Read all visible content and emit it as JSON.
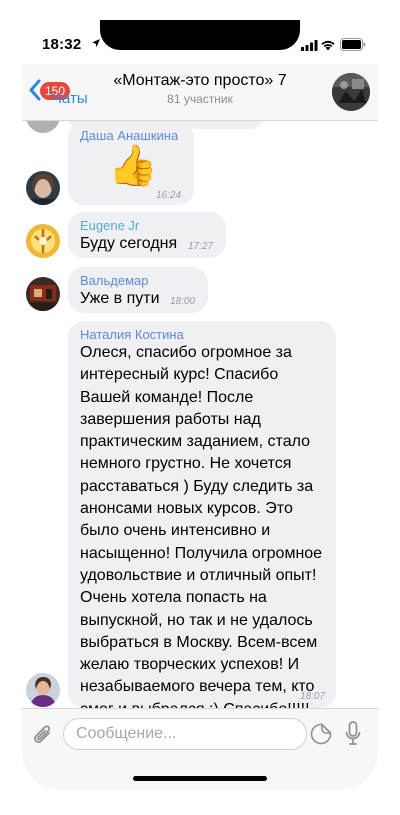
{
  "status_bar": {
    "time": "18:32"
  },
  "nav": {
    "unread_count": "150",
    "back_label": "Чаты",
    "title": "«Монтаж-это просто» 7",
    "subtitle": "81 участник"
  },
  "messages": [
    {
      "sender": "Даша Анашкина",
      "sender_color": "#5b8bd6",
      "content": "👍",
      "time": "16:24"
    },
    {
      "sender": "Eugene Jr",
      "sender_color": "#55aacc",
      "text": "Буду сегодня",
      "time": "17:27"
    },
    {
      "sender": "Вальдемар",
      "sender_color": "#5b8bd6",
      "text": "Уже в пути",
      "time": "18:00"
    },
    {
      "sender": "Наталия Костина",
      "sender_color": "#5b8bd6",
      "lines": [
        "Олеся, спасибо огромное за",
        "интересный курс! Спасибо",
        "Вашей команде! После",
        "завершения работы над",
        "практическим заданием, стало",
        "немного грустно. Не хочется",
        "расставаться ) Буду следить за",
        "анонсами новых курсов. Это",
        "было очень интенсивно и",
        "насыщенно! Получила огромное",
        "удовольствие и отличный опыт!",
        "Очень хотела попасть на",
        "выпускной, но так и не удалось",
        "выбраться в Москву. Всем-всем",
        "желаю творческих успехов! И",
        "незабываемого вечера тем, кто",
        "смог и выбрался :) Спасибо!!!!!"
      ],
      "time": "18:07"
    }
  ],
  "composer": {
    "placeholder": "Сообщение..."
  },
  "colors": {
    "accent": "#2b86e0",
    "badge": "#e5483f",
    "bubble": "#efeff4"
  }
}
